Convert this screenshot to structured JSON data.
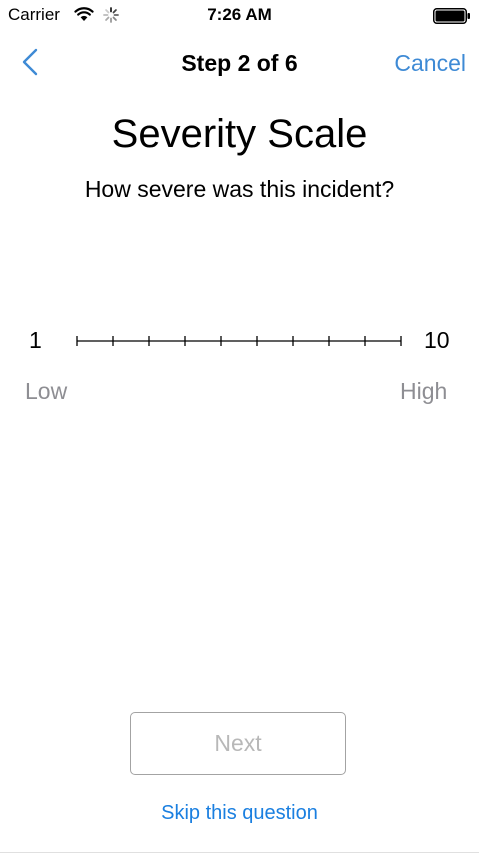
{
  "status_bar": {
    "carrier": "Carrier",
    "time": "7:26 AM",
    "icons": [
      "wifi-icon",
      "activity-spinner-icon",
      "battery-icon"
    ]
  },
  "nav": {
    "back_icon": "chevron-left-icon",
    "title": "Step 2 of 6",
    "cancel_label": "Cancel"
  },
  "content": {
    "title": "Severity Scale",
    "question": "How severe was this incident?"
  },
  "scale": {
    "min_label": "1",
    "max_label": "10",
    "low_text": "Low",
    "high_text": "High",
    "min": 1,
    "max": 10,
    "step": 1,
    "value": null
  },
  "footer": {
    "next_label": "Next",
    "skip_label": "Skip this question"
  },
  "colors": {
    "accent": "#3e8ad5",
    "link": "#1a7fe0",
    "secondary_text": "#8e8e93",
    "disabled_text": "#b8b8b8",
    "button_border": "#a3a3a3"
  }
}
